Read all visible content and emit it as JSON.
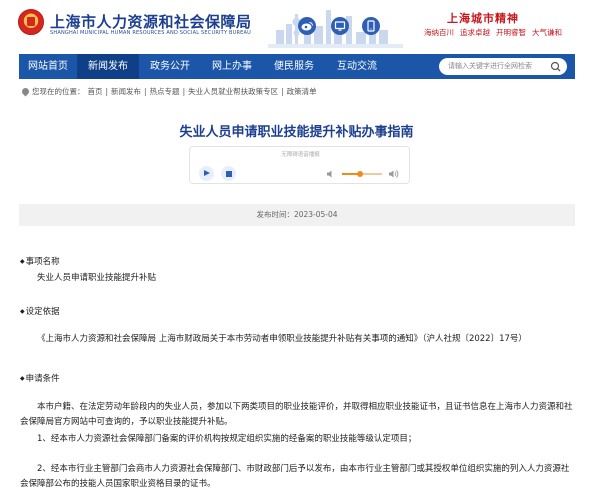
{
  "header": {
    "site_title": "上海市人力资源和社会保障局",
    "site_subtitle": "SHANGHAI MUNICIPAL HUMAN RESOURCES AND SOCIAL SECURITY BUREAU",
    "social_icons": [
      "weibo-icon",
      "computer-icon",
      "mobile-icon"
    ],
    "spirit_title": "上海城市精神",
    "spirit_words": [
      "海纳百川",
      "追求卓越",
      "开明睿智",
      "大气谦和"
    ]
  },
  "nav": {
    "items": [
      "网站首页",
      "新闻发布",
      "政务公开",
      "网上办事",
      "便民服务",
      "互动交流"
    ],
    "active_index": 1,
    "search_placeholder": "请输入关键字进行全网检索"
  },
  "breadcrumb": {
    "label": "您现在的位置：",
    "items": [
      "首页",
      "新闻发布",
      "热点专题",
      "失业人员就业帮扶政策专区",
      "政策清单"
    ],
    "separator": "|"
  },
  "article": {
    "title": "失业人员申请职业技能提升补贴办事指南",
    "player_label": "无障碍语音播报",
    "volume_fraction": 0.45,
    "date": "发布时间：2023-05-04",
    "sections": {
      "s1_head": "事项名称",
      "s1_body": "失业人员申请职业技能提升补贴",
      "s2_head": "设定依据",
      "s2_body": "《上海市人力资源和社会保障局 上海市财政局关于本市劳动者申领职业技能提升补贴有关事项的通知》（沪人社规〔2022〕17号）",
      "s3_head": "申请条件",
      "s3_p1": "本市户籍、在法定劳动年龄段内的失业人员，参加以下两类项目的职业技能评价，并取得相应职业技能证书，且证书信息在上海市人力资源和社会保障局官方网站中可查询的，予以职业技能提升补贴。",
      "s3_p2": "1、经本市人力资源社会保障部门备案的评价机构按规定组织实施的经备案的职业技能等级认定项目；",
      "s3_p3": "2、经本市行业主管部门会商市人力资源社会保障部门、市财政部门后予以发布，由本市行业主管部门或其授权单位组织实施的列入人力资源社会保障部公布的技能人员国家职业资格目录的证书。"
    }
  },
  "colors": {
    "nav_bg": "#1b56a8",
    "nav_active": "#0f3f86",
    "title_blue": "#1d3f8f",
    "spirit_red": "#c8161d",
    "volume_orange": "#f08a1a"
  }
}
